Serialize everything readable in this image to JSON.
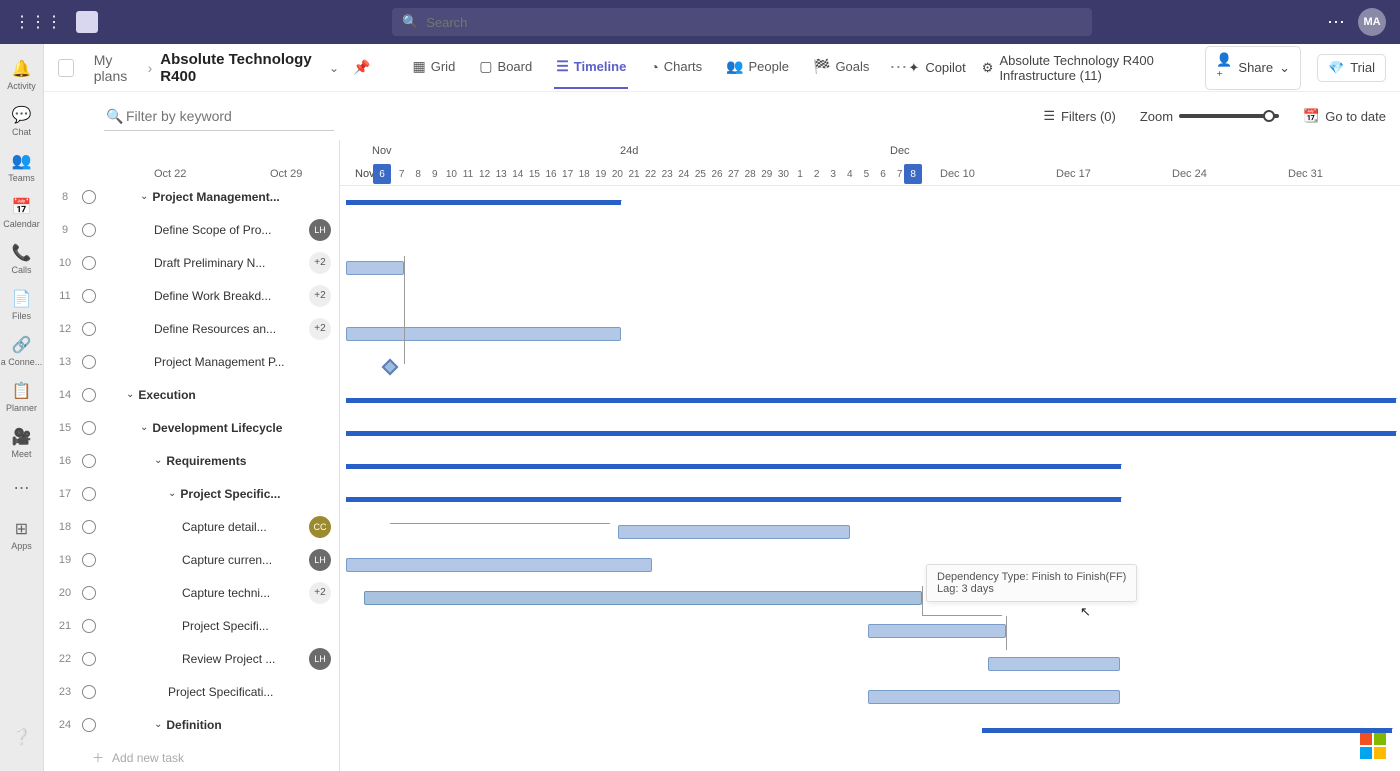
{
  "titlebar": {
    "search_placeholder": "Search",
    "avatar_initials": "MA"
  },
  "leftrail": {
    "items": [
      {
        "icon": "🔔",
        "label": "Activity"
      },
      {
        "icon": "💬",
        "label": "Chat"
      },
      {
        "icon": "👥",
        "label": "Teams"
      },
      {
        "icon": "📅",
        "label": "Calendar"
      },
      {
        "icon": "📞",
        "label": "Calls"
      },
      {
        "icon": "📄",
        "label": "Files"
      },
      {
        "icon": "🔗",
        "label": "a Conne..."
      },
      {
        "icon": "📋",
        "label": "Planner"
      },
      {
        "icon": "🎥",
        "label": "Meet"
      },
      {
        "icon": "⋯",
        "label": ""
      },
      {
        "icon": "⊞",
        "label": "Apps"
      }
    ]
  },
  "breadcrumb": {
    "parent": "My plans",
    "current": "Absolute Technology R400"
  },
  "views": {
    "grid": "Grid",
    "board": "Board",
    "timeline": "Timeline",
    "charts": "Charts",
    "people": "People",
    "goals": "Goals"
  },
  "header_right": {
    "copilot": "Copilot",
    "infra": "Absolute Technology R400 Infrastructure (11)",
    "share": "Share",
    "trial": "Trial"
  },
  "filter": {
    "placeholder": "Filter by keyword",
    "filters_label": "Filters (0)",
    "zoom_label": "Zoom",
    "go_to_date": "Go to date"
  },
  "axis": {
    "oct22": "Oct 22",
    "oct29": "Oct 29",
    "nov": "Nov",
    "duration": "24d",
    "dec": "Dec",
    "dec10": "Dec 10",
    "dec17": "Dec 17",
    "dec24": "Dec 24",
    "dec31": "Dec 31",
    "days": [
      "6",
      "7",
      "8",
      "9",
      "10",
      "11",
      "12",
      "13",
      "14",
      "15",
      "16",
      "17",
      "18",
      "19",
      "20",
      "21",
      "22",
      "23",
      "24",
      "25",
      "26",
      "27",
      "28",
      "29",
      "30",
      "1",
      "2",
      "3",
      "4",
      "5",
      "6",
      "7",
      "8"
    ]
  },
  "tasks": [
    {
      "num": "8",
      "label": "Project Management...",
      "bold": true,
      "caret": true,
      "indent": 1,
      "avatar": null
    },
    {
      "num": "9",
      "label": "Define Scope of Pro...",
      "indent": 2,
      "avatar": "LH"
    },
    {
      "num": "10",
      "label": "Draft Preliminary N...",
      "indent": 2,
      "avatar": "+2"
    },
    {
      "num": "11",
      "label": "Define Work Breakd...",
      "indent": 2,
      "avatar": "+2"
    },
    {
      "num": "12",
      "label": "Define Resources an...",
      "indent": 2,
      "avatar": "+2"
    },
    {
      "num": "13",
      "label": "Project Management P...",
      "indent": 2,
      "avatar": null
    },
    {
      "num": "14",
      "label": "Execution",
      "bold": true,
      "caret": true,
      "indent": 0,
      "avatar": null
    },
    {
      "num": "15",
      "label": "Development Lifecycle",
      "bold": true,
      "caret": true,
      "indent": 1,
      "avatar": null
    },
    {
      "num": "16",
      "label": "Requirements",
      "bold": true,
      "caret": true,
      "indent": 2,
      "avatar": null
    },
    {
      "num": "17",
      "label": "Project Specific...",
      "bold": true,
      "caret": true,
      "indent": 3,
      "avatar": null
    },
    {
      "num": "18",
      "label": "Capture detail...",
      "indent": 4,
      "avatar": "CC",
      "avclass": "olive"
    },
    {
      "num": "19",
      "label": "Capture curren...",
      "indent": 4,
      "avatar": "LH"
    },
    {
      "num": "20",
      "label": "Capture techni...",
      "indent": 4,
      "avatar": "+2"
    },
    {
      "num": "21",
      "label": "Project Specifi...",
      "indent": 4,
      "avatar": null
    },
    {
      "num": "22",
      "label": "Review Project ...",
      "indent": 4,
      "avatar": "LH"
    },
    {
      "num": "23",
      "label": "Project Specificati...",
      "indent": 3,
      "avatar": null
    },
    {
      "num": "24",
      "label": "Definition",
      "bold": true,
      "caret": true,
      "indent": 2,
      "avatar": null
    }
  ],
  "add_task": "Add new task",
  "tooltip": {
    "line1": "Dependency Type: Finish to Finish(FF)",
    "line2": "Lag: 3 days"
  },
  "chart_data": {
    "type": "gantt",
    "time_unit": "days",
    "visible_range": {
      "start": "Oct 22",
      "end": "Dec 31"
    },
    "highlight_range": {
      "start": "Nov 6",
      "end": "Dec 8",
      "label": "24d"
    },
    "bars": [
      {
        "task": 8,
        "kind": "summary",
        "start": "Nov 6",
        "end": "Nov 21"
      },
      {
        "task": 10,
        "kind": "task",
        "start": "Nov 6",
        "end": "Nov 9"
      },
      {
        "task": 12,
        "kind": "task",
        "start": "Nov 6",
        "end": "Nov 21"
      },
      {
        "task": 13,
        "kind": "milestone",
        "date": "Nov 9"
      },
      {
        "task": 14,
        "kind": "summary",
        "start": "Nov 6",
        "end": "open"
      },
      {
        "task": 15,
        "kind": "summary",
        "start": "Nov 6",
        "end": "open"
      },
      {
        "task": 16,
        "kind": "summary",
        "start": "Nov 6",
        "end": "Dec 17"
      },
      {
        "task": 17,
        "kind": "summary",
        "start": "Nov 6",
        "end": "Dec 17"
      },
      {
        "task": 18,
        "kind": "task",
        "start": "Nov 21",
        "end": "Dec 5"
      },
      {
        "task": 19,
        "kind": "task",
        "start": "Nov 6",
        "end": "Nov 24"
      },
      {
        "task": 20,
        "kind": "task",
        "start": "Nov 7",
        "end": "Dec 8"
      },
      {
        "task": 21,
        "kind": "task",
        "start": "Dec 6",
        "end": "Dec 13"
      },
      {
        "task": 22,
        "kind": "task",
        "start": "Dec 12",
        "end": "Dec 17"
      },
      {
        "task": 23,
        "kind": "task",
        "start": "Dec 6",
        "end": "Dec 17"
      },
      {
        "task": 24,
        "kind": "summary",
        "start": "Dec 12",
        "end": "open"
      }
    ],
    "dependencies": [
      {
        "from": 10,
        "to": 13
      },
      {
        "from": 13,
        "to": 18
      },
      {
        "from": 20,
        "to": 21,
        "type": "FF",
        "lag": "3 days"
      },
      {
        "from": 21,
        "to": 22
      },
      {
        "from": 22,
        "to": 23
      }
    ]
  }
}
